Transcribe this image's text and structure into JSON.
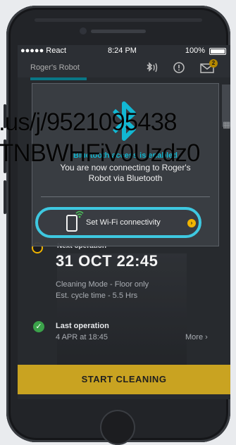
{
  "status_bar": {
    "carrier": "●●●●● React",
    "time": "8:24 PM",
    "battery": "100%"
  },
  "header": {
    "title": "Roger's Robot",
    "mail_badge": "2"
  },
  "modal": {
    "title": "Bluetooth access is enabled",
    "message": "You are now connecting to Roger's Robot via Bluetooth",
    "wifi_label": "Set Wi-Fi connectivity",
    "wifi_arrow": "›"
  },
  "next_operation": {
    "label": "Next operation",
    "datetime": "31 OCT 22:45",
    "mode": "Cleaning Mode - Floor only",
    "cycle": "Est. cycle time - 5.5 Hrs"
  },
  "last_operation": {
    "label": "Last operation",
    "datetime": "4 APR at 18:45",
    "more": "More ›",
    "check": "✓"
  },
  "start_button": "START CLEANING",
  "watermark": {
    "line1": ".us/j/9521095438",
    "line2": "TNBWHFiV0Uzdz0"
  },
  "colors": {
    "accent_cyan": "#3ec8e0",
    "accent_yellow": "#c9a321",
    "success_green": "#3ba24a"
  }
}
